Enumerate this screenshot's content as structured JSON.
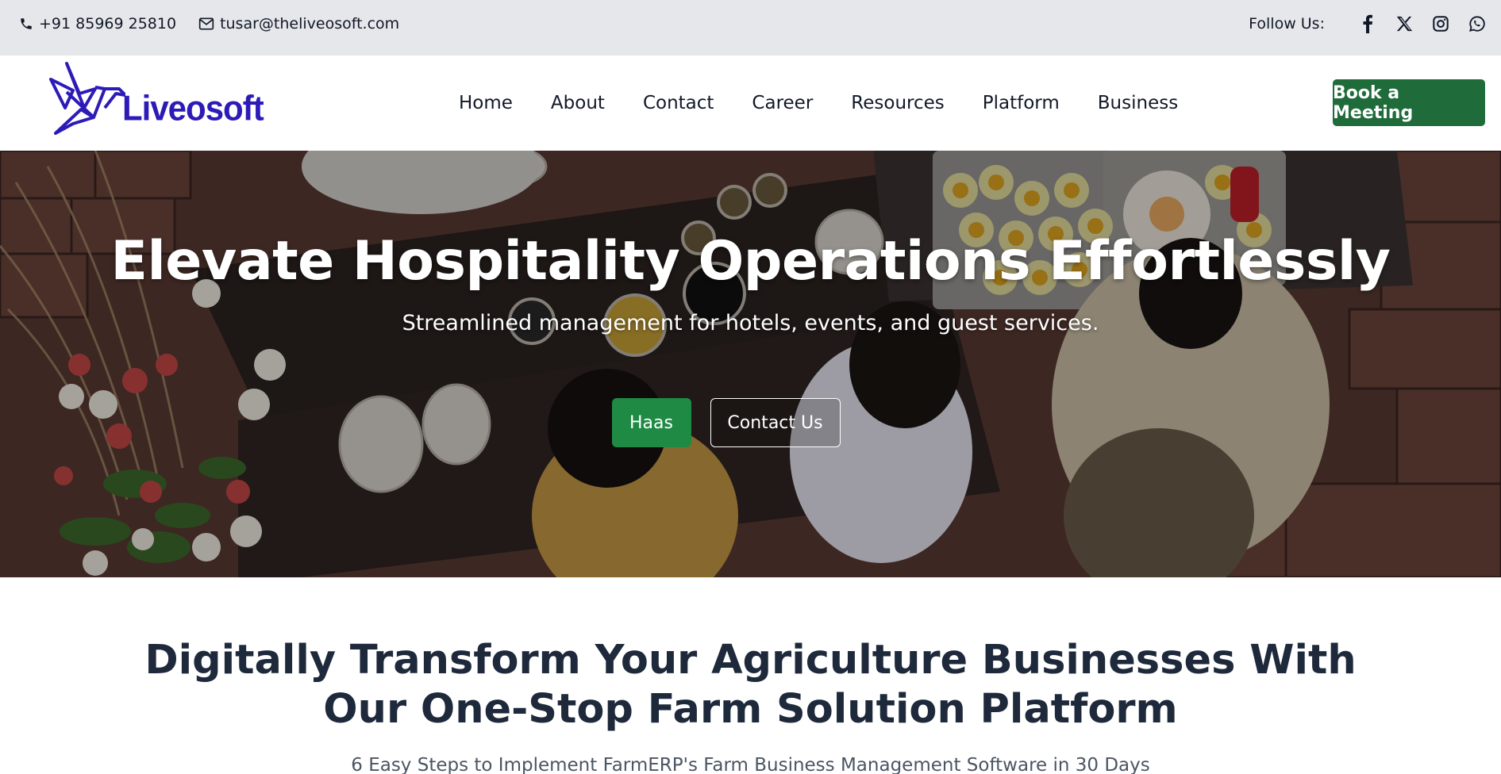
{
  "topbar": {
    "phone": "+91 85969 25810",
    "email": "tusar@theliveosoft.com",
    "follow_label": "Follow Us:",
    "social_icons": [
      "facebook-icon",
      "x-icon",
      "instagram-icon",
      "whatsapp-icon"
    ]
  },
  "brand": {
    "name": "Liveosoft",
    "color": "#2d1bb8"
  },
  "nav": {
    "items": [
      "Home",
      "About",
      "Contact",
      "Career",
      "Resources",
      "Platform",
      "Business"
    ],
    "cta_label": "Book a Meeting",
    "cta_color": "#1f6b3a"
  },
  "hero": {
    "title": "Elevate Hospitality Operations Effortlessly",
    "subtitle": "Streamlined management for hotels, events, and guest services.",
    "primary_button": "Haas",
    "secondary_button": "Contact Us",
    "primary_color": "#1e8a43"
  },
  "section": {
    "title_line1": "Digitally Transform Your Agriculture Businesses With",
    "title_line2": "Our One-Stop Farm Solution Platform",
    "subtitle": "6 Easy Steps to Implement FarmERP's Farm Business Management Software in 30 Days"
  }
}
